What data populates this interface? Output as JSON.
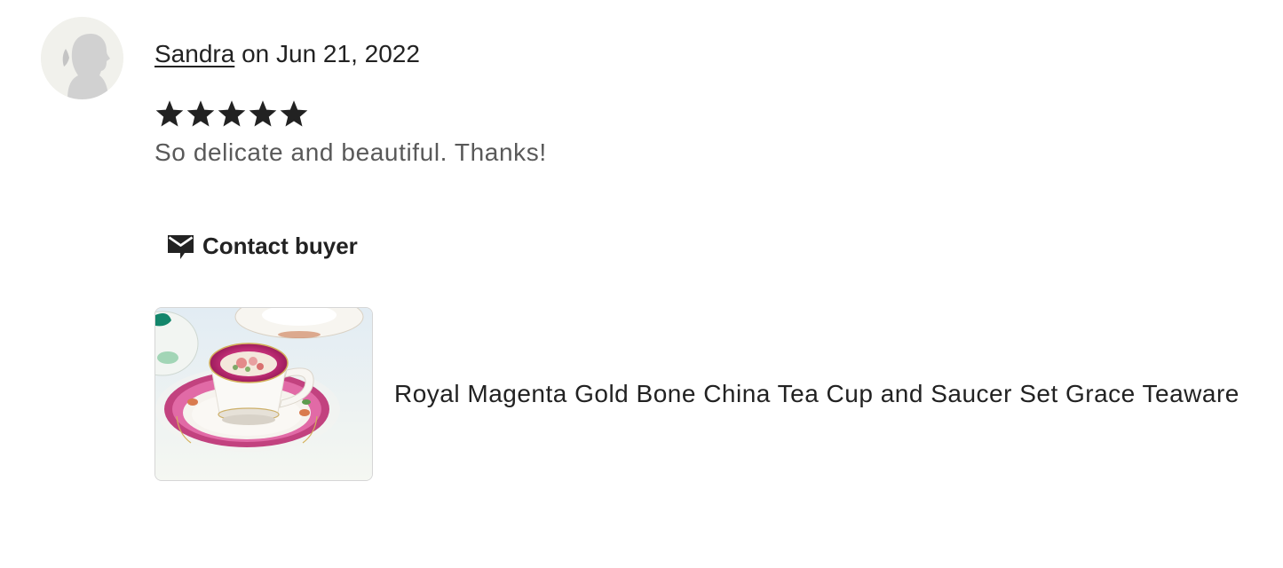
{
  "review": {
    "reviewer_name": "Sandra",
    "date_text": " on Jun 21, 2022",
    "rating": {
      "value": 5,
      "max": 5,
      "label": "5 out of 5 stars"
    },
    "text": "So delicate and beautiful. Thanks!",
    "contact_label": "Contact buyer",
    "product": {
      "title": "Royal Magenta Gold Bone China Tea Cup and Saucer Set Grace Teaware",
      "image_alt": "Royal Magenta Gold Bone China Tea Cup and Saucer Set Grace Teaware"
    }
  },
  "icons": {
    "avatar": "default-user-silhouette",
    "star": "star-filled",
    "contact": "envelope-speech-icon"
  },
  "colors": {
    "text_primary": "#222222",
    "text_secondary": "#595959",
    "avatar_bg": "#f1f1ec",
    "avatar_figure": "#d1d1d1",
    "thumbnail_border": "#d6d6d6"
  }
}
